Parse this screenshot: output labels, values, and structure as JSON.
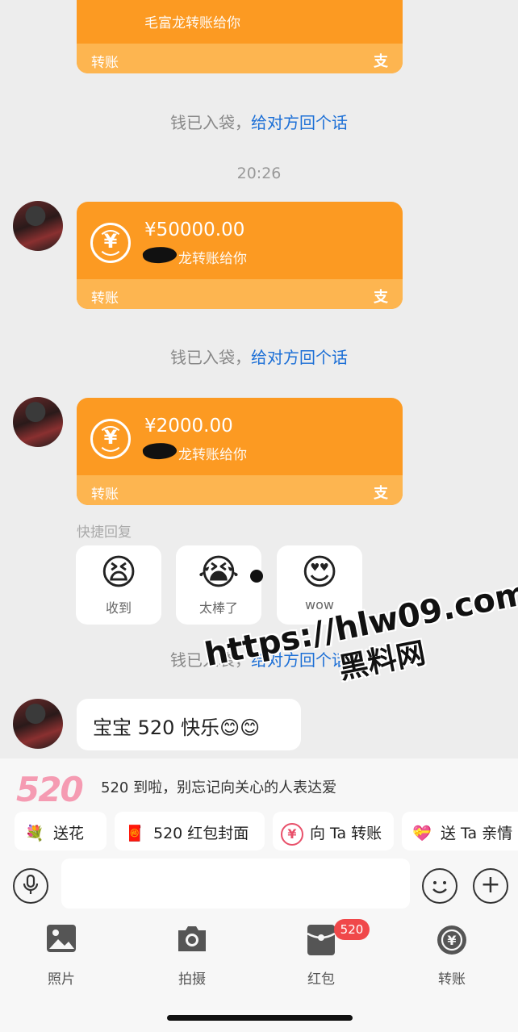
{
  "system_messages": {
    "received": "钱已入袋，",
    "reply_link": "给对方回个话"
  },
  "timestamp": "20:26",
  "transfers": [
    {
      "amount": "",
      "note": "毛富龙转账给你",
      "footer_label": "转账",
      "footer_icon": "支"
    },
    {
      "amount": "¥50000.00",
      "note": "龙转账给你",
      "footer_label": "转账",
      "footer_icon": "支"
    },
    {
      "amount": "¥2000.00",
      "note": "龙转账给你",
      "footer_label": "转账",
      "footer_icon": "支"
    }
  ],
  "quick_reply": {
    "label": "快捷回复",
    "items": [
      {
        "emoji": "😫",
        "text": "收到"
      },
      {
        "emoji": "😭",
        "text": "太棒了"
      },
      {
        "emoji": "😍",
        "text": "wow"
      }
    ]
  },
  "message": "宝宝 520 快乐😊😊",
  "watermark": {
    "url": "https://hlw09.com",
    "name": "黑料网"
  },
  "promo": {
    "logo": "520",
    "text": "520 到啦，别忘记向关心的人表达爱",
    "chips": [
      {
        "icon": "💐",
        "label": "送花"
      },
      {
        "icon": "🧧",
        "label": "520 红包封面"
      },
      {
        "icon": "¥",
        "label": "向 Ta 转账"
      },
      {
        "icon": "💝",
        "label": "送 Ta 亲情"
      }
    ]
  },
  "input": {
    "placeholder": ""
  },
  "toolbar": [
    {
      "icon": "🖼",
      "label": "照片"
    },
    {
      "icon": "📷",
      "label": "拍摄"
    },
    {
      "icon": "🎁",
      "label": "红包"
    },
    {
      "icon": "¥",
      "label": "转账"
    }
  ],
  "badge": "520",
  "colors": {
    "transfer_orange": "#fc9a22",
    "link_blue": "#1c6fd6",
    "badge_red": "#f0484a"
  }
}
